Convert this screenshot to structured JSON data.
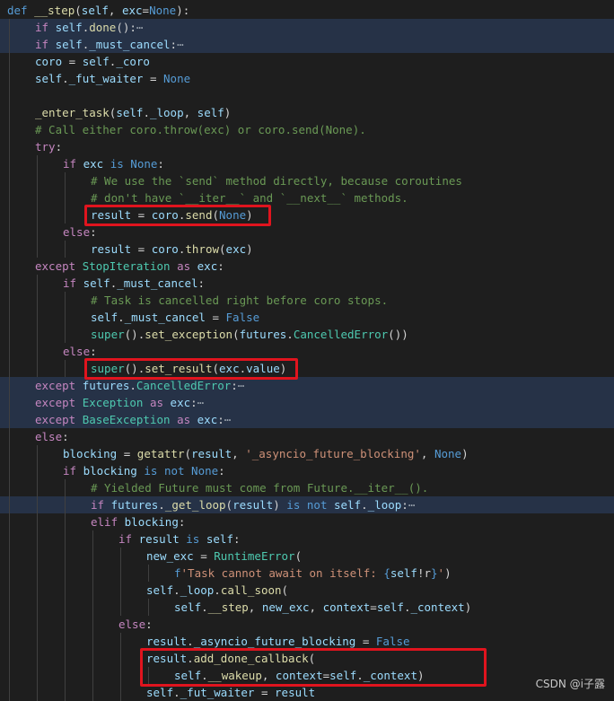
{
  "editor": {
    "colors": {
      "keyword": "#569cd6",
      "control": "#c586c0",
      "function": "#dcdcaa",
      "variable": "#9cdcfe",
      "class": "#4ec9b0",
      "string": "#ce9178",
      "comment": "#6a9955",
      "plain": "#d4d4d4",
      "highlight_box": "#e0141e"
    },
    "lines": [
      {
        "indent": 0,
        "tokens": [
          [
            "def",
            "keyword"
          ],
          [
            " ",
            "plain"
          ],
          [
            "__step",
            "function"
          ],
          [
            "(",
            "plain"
          ],
          [
            "self",
            "variable"
          ],
          [
            ", ",
            "plain"
          ],
          [
            "exc",
            "variable"
          ],
          [
            "=",
            "plain"
          ],
          [
            "None",
            "keyword"
          ],
          [
            "):",
            "plain"
          ]
        ]
      },
      {
        "indent": 1,
        "hl": true,
        "tokens": [
          [
            "if",
            "control"
          ],
          [
            " ",
            "plain"
          ],
          [
            "self",
            "variable"
          ],
          [
            ".",
            "plain"
          ],
          [
            "done",
            "function"
          ],
          [
            "():",
            "plain"
          ],
          [
            "⋯",
            "fold"
          ]
        ]
      },
      {
        "indent": 1,
        "hl": true,
        "tokens": [
          [
            "if",
            "control"
          ],
          [
            " ",
            "plain"
          ],
          [
            "self",
            "variable"
          ],
          [
            ".",
            "plain"
          ],
          [
            "_must_cancel",
            "variable"
          ],
          [
            ":",
            "plain"
          ],
          [
            "⋯",
            "fold"
          ]
        ]
      },
      {
        "indent": 1,
        "tokens": [
          [
            "coro",
            "variable"
          ],
          [
            " = ",
            "plain"
          ],
          [
            "self",
            "variable"
          ],
          [
            ".",
            "plain"
          ],
          [
            "_coro",
            "variable"
          ]
        ]
      },
      {
        "indent": 1,
        "tokens": [
          [
            "self",
            "variable"
          ],
          [
            ".",
            "plain"
          ],
          [
            "_fut_waiter",
            "variable"
          ],
          [
            " = ",
            "plain"
          ],
          [
            "None",
            "keyword"
          ]
        ]
      },
      {
        "indent": 1,
        "tokens": []
      },
      {
        "indent": 1,
        "tokens": [
          [
            "_enter_task",
            "function"
          ],
          [
            "(",
            "plain"
          ],
          [
            "self",
            "variable"
          ],
          [
            ".",
            "plain"
          ],
          [
            "_loop",
            "variable"
          ],
          [
            ", ",
            "plain"
          ],
          [
            "self",
            "variable"
          ],
          [
            ")",
            "plain"
          ]
        ]
      },
      {
        "indent": 1,
        "tokens": [
          [
            "# Call either coro.throw(exc) or coro.send(None).",
            "comment"
          ]
        ]
      },
      {
        "indent": 1,
        "tokens": [
          [
            "try",
            "control"
          ],
          [
            ":",
            "plain"
          ]
        ]
      },
      {
        "indent": 2,
        "tokens": [
          [
            "if",
            "control"
          ],
          [
            " ",
            "plain"
          ],
          [
            "exc",
            "variable"
          ],
          [
            " ",
            "plain"
          ],
          [
            "is",
            "keyword"
          ],
          [
            " ",
            "plain"
          ],
          [
            "None",
            "keyword"
          ],
          [
            ":",
            "plain"
          ]
        ]
      },
      {
        "indent": 3,
        "tokens": [
          [
            "# We use the `send` method directly, because coroutines",
            "comment"
          ]
        ]
      },
      {
        "indent": 3,
        "tokens": [
          [
            "# don't have `__iter__` and `__next__` methods.",
            "comment"
          ]
        ]
      },
      {
        "indent": 3,
        "tokens": [
          [
            "result",
            "variable"
          ],
          [
            " = ",
            "plain"
          ],
          [
            "coro",
            "variable"
          ],
          [
            ".",
            "plain"
          ],
          [
            "send",
            "function"
          ],
          [
            "(",
            "plain"
          ],
          [
            "None",
            "keyword"
          ],
          [
            ")",
            "plain"
          ]
        ]
      },
      {
        "indent": 2,
        "tokens": [
          [
            "else",
            "control"
          ],
          [
            ":",
            "plain"
          ]
        ]
      },
      {
        "indent": 3,
        "tokens": [
          [
            "result",
            "variable"
          ],
          [
            " = ",
            "plain"
          ],
          [
            "coro",
            "variable"
          ],
          [
            ".",
            "plain"
          ],
          [
            "throw",
            "function"
          ],
          [
            "(",
            "plain"
          ],
          [
            "exc",
            "variable"
          ],
          [
            ")",
            "plain"
          ]
        ]
      },
      {
        "indent": 1,
        "tokens": [
          [
            "except",
            "control"
          ],
          [
            " ",
            "plain"
          ],
          [
            "StopIteration",
            "class"
          ],
          [
            " ",
            "plain"
          ],
          [
            "as",
            "control"
          ],
          [
            " ",
            "plain"
          ],
          [
            "exc",
            "variable"
          ],
          [
            ":",
            "plain"
          ]
        ]
      },
      {
        "indent": 2,
        "tokens": [
          [
            "if",
            "control"
          ],
          [
            " ",
            "plain"
          ],
          [
            "self",
            "variable"
          ],
          [
            ".",
            "plain"
          ],
          [
            "_must_cancel",
            "variable"
          ],
          [
            ":",
            "plain"
          ]
        ]
      },
      {
        "indent": 3,
        "tokens": [
          [
            "# Task is cancelled right before coro stops.",
            "comment"
          ]
        ]
      },
      {
        "indent": 3,
        "tokens": [
          [
            "self",
            "variable"
          ],
          [
            ".",
            "plain"
          ],
          [
            "_must_cancel",
            "variable"
          ],
          [
            " = ",
            "plain"
          ],
          [
            "False",
            "keyword"
          ]
        ]
      },
      {
        "indent": 3,
        "tokens": [
          [
            "super",
            "class"
          ],
          [
            "().",
            "plain"
          ],
          [
            "set_exception",
            "function"
          ],
          [
            "(",
            "plain"
          ],
          [
            "futures",
            "variable"
          ],
          [
            ".",
            "plain"
          ],
          [
            "CancelledError",
            "class"
          ],
          [
            "())",
            "plain"
          ]
        ]
      },
      {
        "indent": 2,
        "tokens": [
          [
            "else",
            "control"
          ],
          [
            ":",
            "plain"
          ]
        ]
      },
      {
        "indent": 3,
        "tokens": [
          [
            "super",
            "class"
          ],
          [
            "().",
            "plain"
          ],
          [
            "set_result",
            "function"
          ],
          [
            "(",
            "plain"
          ],
          [
            "exc",
            "variable"
          ],
          [
            ".",
            "plain"
          ],
          [
            "value",
            "variable"
          ],
          [
            ")",
            "plain"
          ]
        ]
      },
      {
        "indent": 1,
        "hl": true,
        "tokens": [
          [
            "except",
            "control"
          ],
          [
            " ",
            "plain"
          ],
          [
            "futures",
            "variable"
          ],
          [
            ".",
            "plain"
          ],
          [
            "CancelledError",
            "class"
          ],
          [
            ":",
            "plain"
          ],
          [
            "⋯",
            "fold"
          ]
        ]
      },
      {
        "indent": 1,
        "hl": true,
        "tokens": [
          [
            "except",
            "control"
          ],
          [
            " ",
            "plain"
          ],
          [
            "Exception",
            "class"
          ],
          [
            " ",
            "plain"
          ],
          [
            "as",
            "control"
          ],
          [
            " ",
            "plain"
          ],
          [
            "exc",
            "variable"
          ],
          [
            ":",
            "plain"
          ],
          [
            "⋯",
            "fold"
          ]
        ]
      },
      {
        "indent": 1,
        "hl": true,
        "tokens": [
          [
            "except",
            "control"
          ],
          [
            " ",
            "plain"
          ],
          [
            "BaseException",
            "class"
          ],
          [
            " ",
            "plain"
          ],
          [
            "as",
            "control"
          ],
          [
            " ",
            "plain"
          ],
          [
            "exc",
            "variable"
          ],
          [
            ":",
            "plain"
          ],
          [
            "⋯",
            "fold"
          ]
        ]
      },
      {
        "indent": 1,
        "tokens": [
          [
            "else",
            "control"
          ],
          [
            ":",
            "plain"
          ]
        ]
      },
      {
        "indent": 2,
        "tokens": [
          [
            "blocking",
            "variable"
          ],
          [
            " = ",
            "plain"
          ],
          [
            "getattr",
            "function"
          ],
          [
            "(",
            "plain"
          ],
          [
            "result",
            "variable"
          ],
          [
            ", ",
            "plain"
          ],
          [
            "'_asyncio_future_blocking'",
            "string"
          ],
          [
            ", ",
            "plain"
          ],
          [
            "None",
            "keyword"
          ],
          [
            ")",
            "plain"
          ]
        ]
      },
      {
        "indent": 2,
        "tokens": [
          [
            "if",
            "control"
          ],
          [
            " ",
            "plain"
          ],
          [
            "blocking",
            "variable"
          ],
          [
            " ",
            "plain"
          ],
          [
            "is",
            "keyword"
          ],
          [
            " ",
            "plain"
          ],
          [
            "not",
            "keyword"
          ],
          [
            " ",
            "plain"
          ],
          [
            "None",
            "keyword"
          ],
          [
            ":",
            "plain"
          ]
        ]
      },
      {
        "indent": 3,
        "tokens": [
          [
            "# Yielded Future must come from Future.__iter__().",
            "comment"
          ]
        ]
      },
      {
        "indent": 3,
        "hl": true,
        "tokens": [
          [
            "if",
            "control"
          ],
          [
            " ",
            "plain"
          ],
          [
            "futures",
            "variable"
          ],
          [
            ".",
            "plain"
          ],
          [
            "_get_loop",
            "function"
          ],
          [
            "(",
            "plain"
          ],
          [
            "result",
            "variable"
          ],
          [
            ") ",
            "plain"
          ],
          [
            "is",
            "keyword"
          ],
          [
            " ",
            "plain"
          ],
          [
            "not",
            "keyword"
          ],
          [
            " ",
            "plain"
          ],
          [
            "self",
            "variable"
          ],
          [
            ".",
            "plain"
          ],
          [
            "_loop",
            "variable"
          ],
          [
            ":",
            "plain"
          ],
          [
            "⋯",
            "fold"
          ]
        ]
      },
      {
        "indent": 3,
        "tokens": [
          [
            "elif",
            "control"
          ],
          [
            " ",
            "plain"
          ],
          [
            "blocking",
            "variable"
          ],
          [
            ":",
            "plain"
          ]
        ]
      },
      {
        "indent": 4,
        "tokens": [
          [
            "if",
            "control"
          ],
          [
            " ",
            "plain"
          ],
          [
            "result",
            "variable"
          ],
          [
            " ",
            "plain"
          ],
          [
            "is",
            "keyword"
          ],
          [
            " ",
            "plain"
          ],
          [
            "self",
            "variable"
          ],
          [
            ":",
            "plain"
          ]
        ]
      },
      {
        "indent": 5,
        "tokens": [
          [
            "new_exc",
            "variable"
          ],
          [
            " = ",
            "plain"
          ],
          [
            "RuntimeError",
            "class"
          ],
          [
            "(",
            "plain"
          ]
        ]
      },
      {
        "indent": 6,
        "tokens": [
          [
            "f",
            "keyword"
          ],
          [
            "'Task cannot await on itself: ",
            "string"
          ],
          [
            "{",
            "keyword"
          ],
          [
            "self",
            "variable"
          ],
          [
            "!r",
            "plain"
          ],
          [
            "}",
            "keyword"
          ],
          [
            "'",
            "string"
          ],
          [
            ")",
            "plain"
          ]
        ]
      },
      {
        "indent": 5,
        "tokens": [
          [
            "self",
            "variable"
          ],
          [
            ".",
            "plain"
          ],
          [
            "_loop",
            "variable"
          ],
          [
            ".",
            "plain"
          ],
          [
            "call_soon",
            "function"
          ],
          [
            "(",
            "plain"
          ]
        ]
      },
      {
        "indent": 6,
        "tokens": [
          [
            "self",
            "variable"
          ],
          [
            ".",
            "plain"
          ],
          [
            "__step",
            "function"
          ],
          [
            ", ",
            "plain"
          ],
          [
            "new_exc",
            "variable"
          ],
          [
            ", ",
            "plain"
          ],
          [
            "context",
            "variable"
          ],
          [
            "=",
            "plain"
          ],
          [
            "self",
            "variable"
          ],
          [
            ".",
            "plain"
          ],
          [
            "_context",
            "variable"
          ],
          [
            ")",
            "plain"
          ]
        ]
      },
      {
        "indent": 4,
        "tokens": [
          [
            "else",
            "control"
          ],
          [
            ":",
            "plain"
          ]
        ]
      },
      {
        "indent": 5,
        "tokens": [
          [
            "result",
            "variable"
          ],
          [
            ".",
            "plain"
          ],
          [
            "_asyncio_future_blocking",
            "variable"
          ],
          [
            " = ",
            "plain"
          ],
          [
            "False",
            "keyword"
          ]
        ]
      },
      {
        "indent": 5,
        "tokens": [
          [
            "result",
            "variable"
          ],
          [
            ".",
            "plain"
          ],
          [
            "add_done_callback",
            "function"
          ],
          [
            "(",
            "plain"
          ]
        ]
      },
      {
        "indent": 6,
        "tokens": [
          [
            "self",
            "variable"
          ],
          [
            ".",
            "plain"
          ],
          [
            "__wakeup",
            "function"
          ],
          [
            ", ",
            "plain"
          ],
          [
            "context",
            "variable"
          ],
          [
            "=",
            "plain"
          ],
          [
            "self",
            "variable"
          ],
          [
            ".",
            "plain"
          ],
          [
            "_context",
            "variable"
          ],
          [
            ")",
            "plain"
          ]
        ]
      },
      {
        "indent": 5,
        "tokens": [
          [
            "self",
            "variable"
          ],
          [
            ".",
            "plain"
          ],
          [
            "_fut_waiter",
            "variable"
          ],
          [
            " = ",
            "plain"
          ],
          [
            "result",
            "variable"
          ]
        ]
      }
    ]
  },
  "watermark": "CSDN @i子露"
}
